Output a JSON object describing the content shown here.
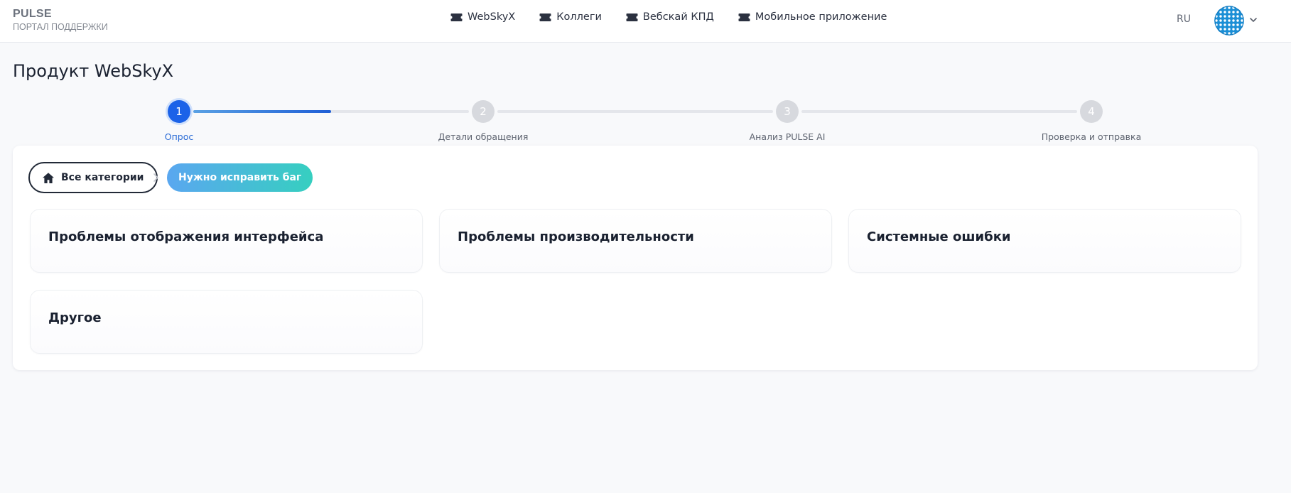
{
  "header": {
    "brand_title": "PULSE",
    "brand_subtitle": "ПОРТАЛ ПОДДЕРЖКИ",
    "nav": [
      {
        "label": "WebSkyX",
        "icon": "ticket-icon"
      },
      {
        "label": "Коллеги",
        "icon": "ticket-icon"
      },
      {
        "label": "Вебскай КПД",
        "icon": "ticket-icon"
      },
      {
        "label": "Мобильное приложение",
        "icon": "ticket-icon"
      }
    ],
    "language": "RU",
    "avatar_icon": "avatar-pattern-icon",
    "menu_icon": "chevron-down-icon"
  },
  "page": {
    "title": "Продукт WebSkyX"
  },
  "stepper": {
    "current_step": 1,
    "progress_to_next": 0.5,
    "steps": [
      {
        "number": "1",
        "label": "Опрос"
      },
      {
        "number": "2",
        "label": "Детали обращения"
      },
      {
        "number": "3",
        "label": "Анализ PULSE AI"
      },
      {
        "number": "4",
        "label": "Проверка и отправка"
      }
    ]
  },
  "breadcrumb": {
    "home_label": "Все категории",
    "home_icon": "home-icon",
    "separator_icon": "chevron-right-icon",
    "active_label": "Нужно исправить баг"
  },
  "options": [
    {
      "label": "Проблемы отображения интерфейса"
    },
    {
      "label": "Проблемы производительности"
    },
    {
      "label": "Системные ошибки"
    },
    {
      "label": "Другое"
    }
  ],
  "colors": {
    "accent": "#1b62e8",
    "progress_start": "#5aa1e4",
    "progress_end": "#1f5fd6",
    "crumb_gradient_start": "#5aa7f0",
    "crumb_gradient_end": "#36cfc0",
    "avatar_blue": "#1b8fd6"
  }
}
